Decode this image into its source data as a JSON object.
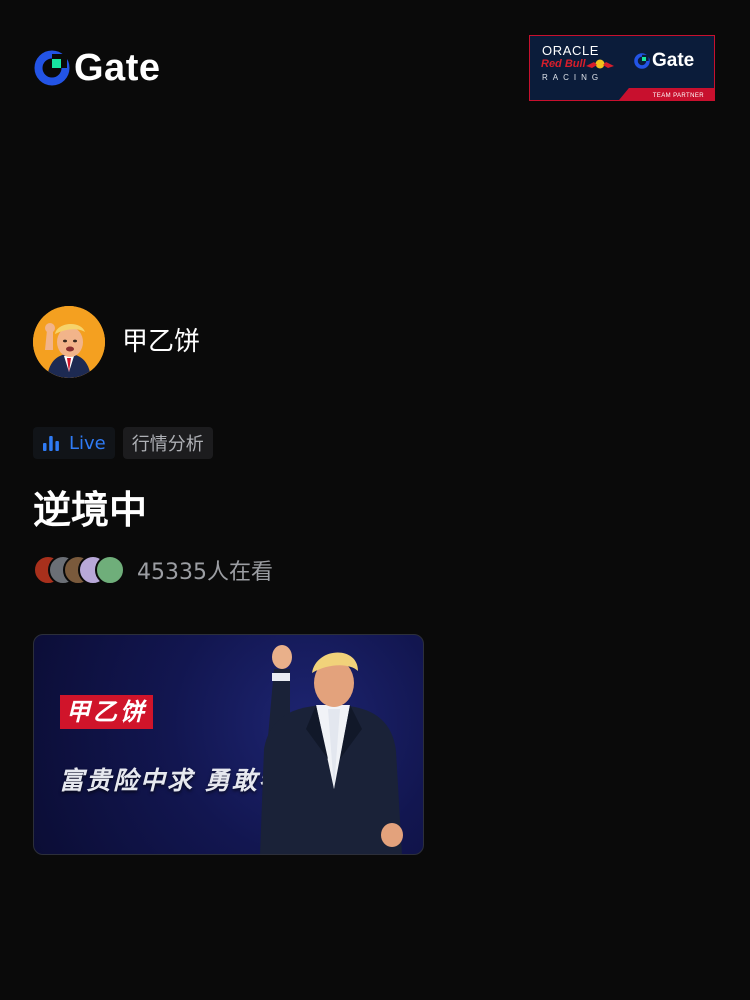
{
  "brand": {
    "name": "Gate",
    "logo_icon": "gate-logo-icon",
    "accent_blue": "#2354e6",
    "accent_green": "#17e6a1"
  },
  "partner_badge": {
    "line1": "ORACLE",
    "line2": "Red Bull",
    "line3": "RACING",
    "brand": "Gate",
    "strip": "TEAM PARTNER",
    "bg_color": "#0b1c3a",
    "accent_red": "#c8102e"
  },
  "host": {
    "name": "甲乙饼",
    "avatar_icon": "host-avatar"
  },
  "tags": {
    "live_label": "Live",
    "live_icon": "bar-chart-icon",
    "topic_label": "行情分析",
    "live_color": "#2f7bf5"
  },
  "stream": {
    "title": "逆境中",
    "viewer_count": "45335人在看"
  },
  "cover": {
    "label": "甲乙饼",
    "slogan": "富贵险中求 勇敢者游戏",
    "label_color": "#d0142a"
  }
}
